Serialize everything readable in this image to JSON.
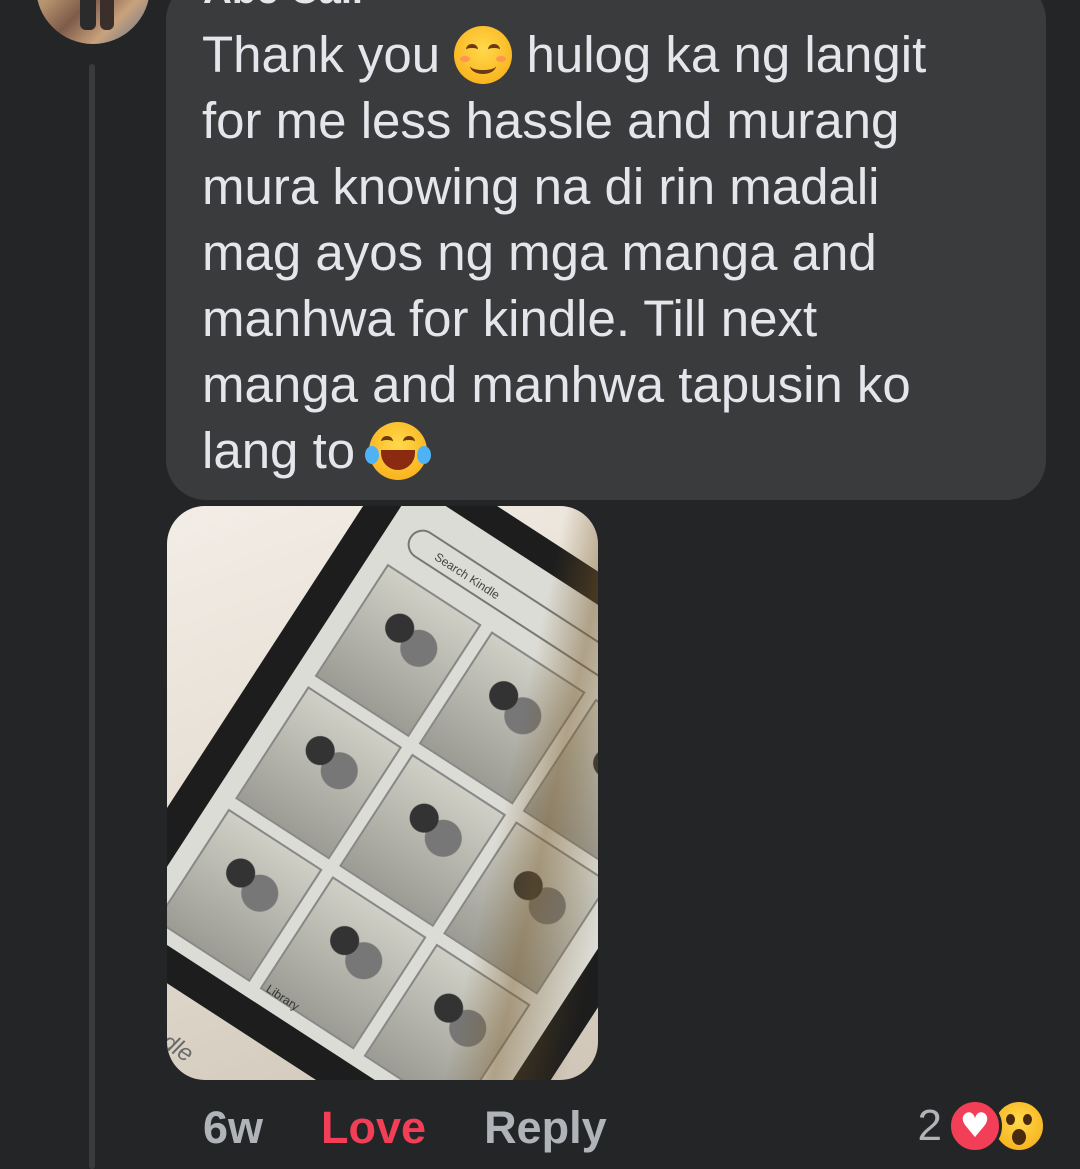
{
  "comment": {
    "author": "Abe Calr",
    "lines": [
      "Thank you ",
      " hulog ka ng langit",
      "for me less hassle and  murang",
      "mura knowing na di rin madali",
      "mag ayos ng mga manga and",
      "manhwa for kindle. Till next",
      "manga and manhwa tapusin ko",
      "lang to "
    ],
    "emojis": [
      "smiling-face-icon",
      "tears-of-joy-icon"
    ]
  },
  "photo": {
    "search_placeholder": "Search Kindle",
    "library_label": "Library",
    "brand": "kindle"
  },
  "actions": {
    "time": "6w",
    "love_label": "Love",
    "reply_label": "Reply"
  },
  "reactions": {
    "count": "2",
    "types": [
      "heart-icon",
      "wow-icon"
    ]
  },
  "colors": {
    "background": "#242526",
    "bubble": "#3a3b3c",
    "text": "#e4e6eb",
    "muted": "#b0b3b8",
    "love": "#f33e58"
  }
}
